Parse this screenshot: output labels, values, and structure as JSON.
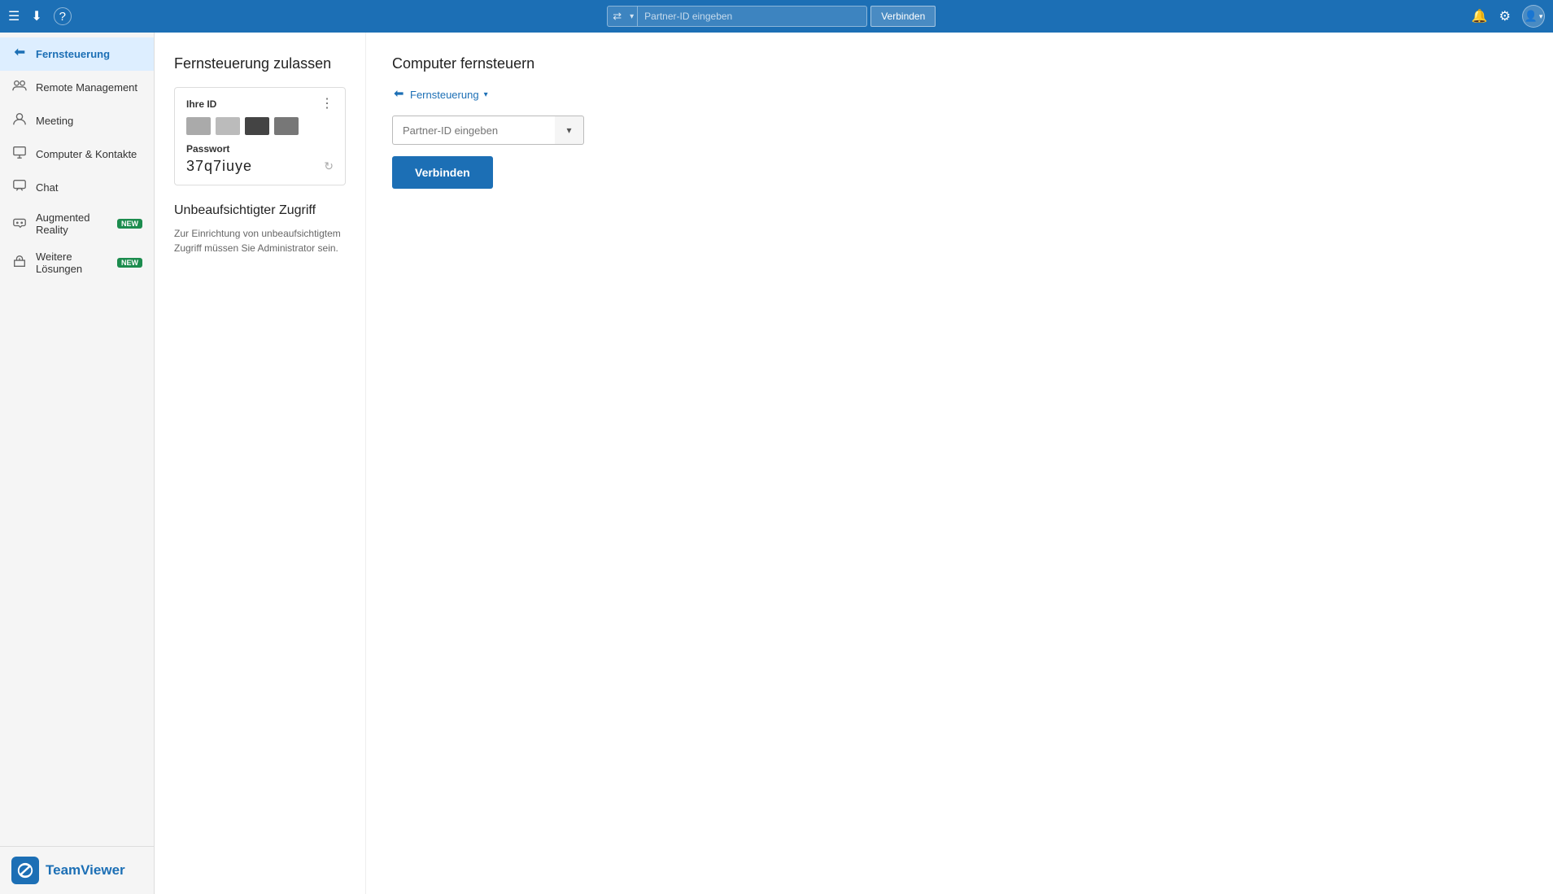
{
  "topbar": {
    "partner_id_placeholder": "Partner-ID eingeben",
    "connect_label": "Verbinden",
    "icons": {
      "menu": "☰",
      "download": "⬇",
      "help": "?",
      "bell": "🔔",
      "settings": "⚙",
      "user": "👤",
      "arrow": "▼"
    }
  },
  "sidebar": {
    "items": [
      {
        "id": "fernsteuerung",
        "label": "Fernsteuerung",
        "icon": "🔀",
        "active": true,
        "badge": ""
      },
      {
        "id": "remote-management",
        "label": "Remote Management",
        "icon": "👥",
        "active": false,
        "badge": ""
      },
      {
        "id": "meeting",
        "label": "Meeting",
        "icon": "👤",
        "active": false,
        "badge": ""
      },
      {
        "id": "computer-kontakte",
        "label": "Computer & Kontakte",
        "icon": "📋",
        "active": false,
        "badge": ""
      },
      {
        "id": "chat",
        "label": "Chat",
        "icon": "💬",
        "active": false,
        "badge": ""
      },
      {
        "id": "augmented-reality",
        "label": "Augmented Reality",
        "icon": "👓",
        "active": false,
        "badge": "NEW"
      },
      {
        "id": "weitere-loesungen",
        "label": "Weitere Lösungen",
        "icon": "🎁",
        "active": false,
        "badge": "NEW"
      }
    ],
    "footer": {
      "logo_text": "TeamViewer"
    }
  },
  "left_panel": {
    "section_title": "Fernsteuerung zulassen",
    "id_card": {
      "id_label": "Ihre ID",
      "menu_icon": "⋮",
      "password_label": "Passwort",
      "password_value": "37q7iuye",
      "refresh_icon": "↻"
    },
    "unattended": {
      "title": "Unbeaufsichtigter Zugriff",
      "description": "Zur Einrichtung von unbeaufsichtigtem Zugriff müssen Sie Administrator sein."
    }
  },
  "right_panel": {
    "section_title": "Computer fernsteuern",
    "fernsteuerung_label": "Fernsteuerung",
    "partner_id_placeholder": "Partner-ID eingeben",
    "connect_button_label": "Verbinden",
    "icons": {
      "link_icon": "🔀",
      "chevron": "▾",
      "dropdown": "▾"
    }
  }
}
